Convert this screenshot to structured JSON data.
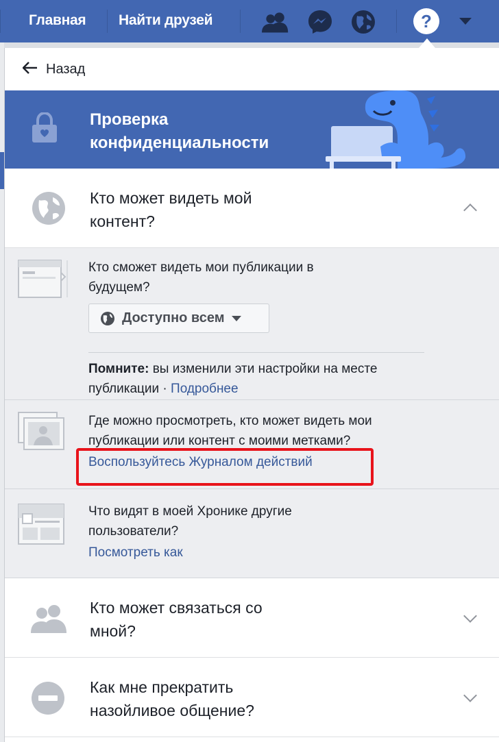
{
  "topbar": {
    "nav_home": "Главная",
    "nav_find_friends": "Найти друзей",
    "icons": [
      "friends-icon",
      "messenger-icon",
      "globe-notifications-icon",
      "help-icon",
      "caret-down-icon"
    ],
    "help_glyph": "?"
  },
  "panel": {
    "back_label": "Назад",
    "banner_title": "Проверка конфиденциальности",
    "sections": {
      "content": {
        "title": "Кто может видеть мой контент?",
        "future_posts": {
          "question": "Кто сможет видеть мои публикации в будущем?",
          "visibility": "Доступно всем",
          "note_bold": "Помните:",
          "note_text": " вы изменили эти настройки на месте публикации · ",
          "note_link": "Подробнее"
        },
        "activity_log": {
          "question": "Где можно просмотреть, кто может видеть мои публикации или контент с моими метками?",
          "link": "Воспользуйтесь Журналом действий"
        },
        "timeline": {
          "question": "Что видят в моей Хронике другие пользователи?",
          "link": "Посмотреть как"
        }
      },
      "contact": {
        "title": "Кто может связаться со мной?"
      },
      "block": {
        "title": "Как мне прекратить назойливое общение?"
      }
    }
  },
  "colors": {
    "brand_blue": "#4267b2",
    "link_blue": "#365899",
    "highlight_red": "#e8131b"
  }
}
